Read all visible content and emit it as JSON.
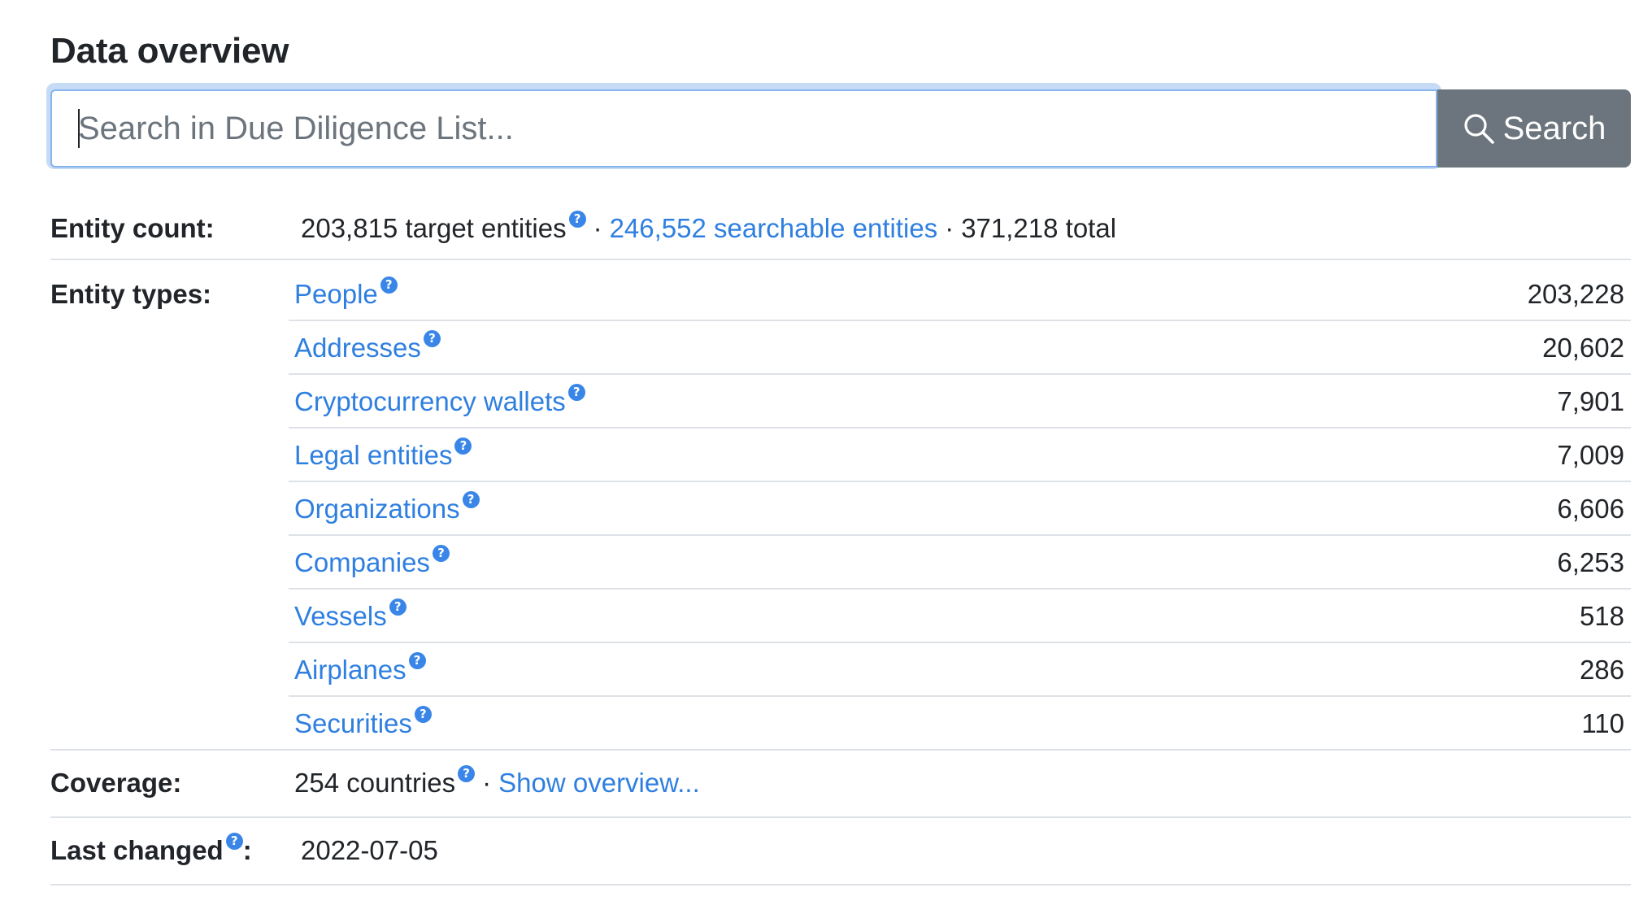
{
  "heading": "Data overview",
  "search": {
    "placeholder": "Search in Due Diligence List...",
    "button_label": "Search"
  },
  "help_glyph": "?",
  "entity_count": {
    "label": "Entity count:",
    "target": "203,815 target entities",
    "separator": "·",
    "searchable": "246,552 searchable entities",
    "total": "371,218 total"
  },
  "entity_types": {
    "label": "Entity types:",
    "items": [
      {
        "name": "People",
        "count": "203,228"
      },
      {
        "name": "Addresses",
        "count": "20,602"
      },
      {
        "name": "Cryptocurrency wallets",
        "count": "7,901"
      },
      {
        "name": "Legal entities",
        "count": "7,009"
      },
      {
        "name": "Organizations",
        "count": "6,606"
      },
      {
        "name": "Companies",
        "count": "6,253"
      },
      {
        "name": "Vessels",
        "count": "518"
      },
      {
        "name": "Airplanes",
        "count": "286"
      },
      {
        "name": "Securities",
        "count": "110"
      }
    ]
  },
  "coverage": {
    "label": "Coverage:",
    "countries": "254 countries",
    "separator": "·",
    "link": "Show overview..."
  },
  "last_changed": {
    "label": "Last changed",
    "colon": ":",
    "value": "2022-07-05"
  },
  "colors": {
    "link": "#2f7fe0",
    "help_badge": "#3a86e8",
    "search_button": "#6c757d",
    "focus_ring": "#c6dbf6",
    "divider": "#dee2e6"
  }
}
